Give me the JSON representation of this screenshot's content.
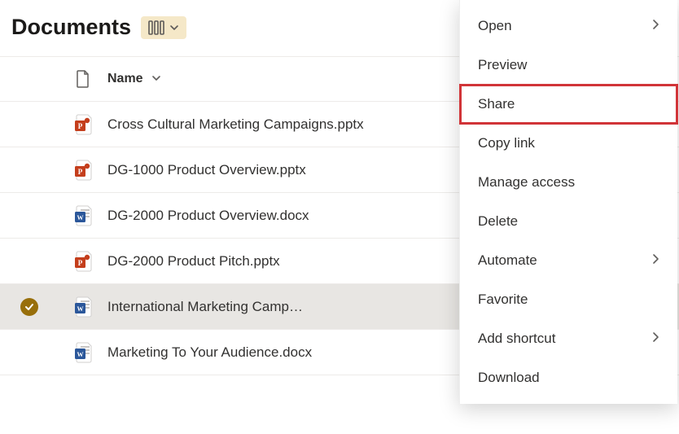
{
  "header": {
    "title": "Documents"
  },
  "columns": {
    "name": "Name"
  },
  "files": [
    {
      "name": "Cross Cultural Marketing Campaigns.pptx",
      "type": "pptx",
      "selected": false
    },
    {
      "name": "DG-1000 Product Overview.pptx",
      "type": "pptx",
      "selected": false
    },
    {
      "name": "DG-2000 Product Overview.docx",
      "type": "docx",
      "selected": false
    },
    {
      "name": "DG-2000 Product Pitch.pptx",
      "type": "pptx",
      "selected": false
    },
    {
      "name": "International Marketing Camp…",
      "type": "docx",
      "selected": true
    },
    {
      "name": "Marketing To Your Audience.docx",
      "type": "docx",
      "selected": false
    }
  ],
  "menu": {
    "open": "Open",
    "preview": "Preview",
    "share": "Share",
    "copy_link": "Copy link",
    "manage_access": "Manage access",
    "delete": "Delete",
    "automate": "Automate",
    "favorite": "Favorite",
    "add_shortcut": "Add shortcut",
    "download": "Download"
  },
  "icons": {
    "pptx_color": "#c43e1c",
    "docx_color": "#2b579a"
  },
  "highlight_menu_item": "share"
}
